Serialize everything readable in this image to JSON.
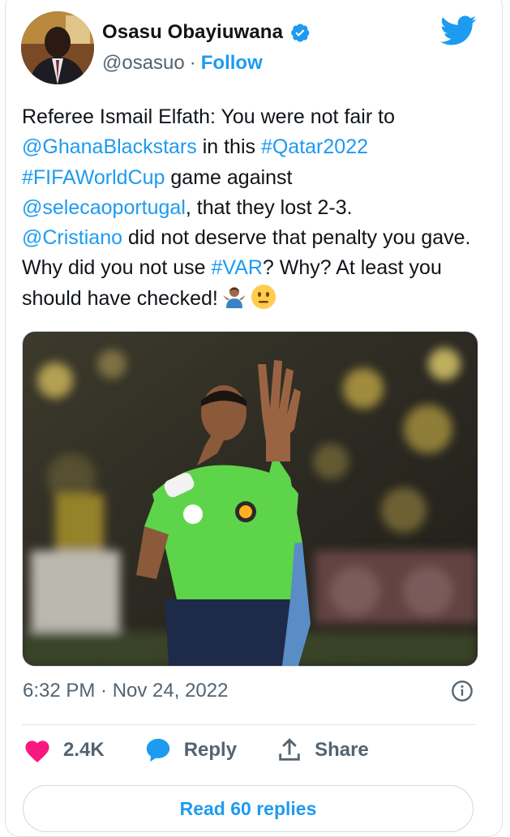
{
  "author": {
    "name": "Osasu Obayiuwana",
    "handle": "@osasuo",
    "separator": "·",
    "follow_label": "Follow"
  },
  "tweet": {
    "t1": "Referee Ismail Elfath: You were not fair to",
    "m1": "@GhanaBlackstars",
    "t2": " in this ",
    "h1": "#Qatar2022",
    "h2": "#FIFAWorldCup",
    "t3": " game against",
    "m2": "@selecaoportugal",
    "t4": ", that they lost 2-3.",
    "m3": "@Cristiano",
    "t5": " did not deserve that penalty you gave. Why did you not use ",
    "h3": "#VAR",
    "t6": "? Why? At least you should have checked!",
    "emojis": [
      "person-shrugging-emoji",
      "neutral-face-emoji"
    ]
  },
  "media": {
    "description_icon": "referee-photo"
  },
  "meta": {
    "timestamp": "6:32 PM · Nov 24, 2022"
  },
  "actions": {
    "like_count": "2.4K",
    "reply_label": "Reply",
    "share_label": "Share"
  },
  "replies_button": "Read 60 replies",
  "colors": {
    "accent": "#1d9bf0",
    "like": "#f91880",
    "text": "#0f1419",
    "muted": "#536471"
  }
}
